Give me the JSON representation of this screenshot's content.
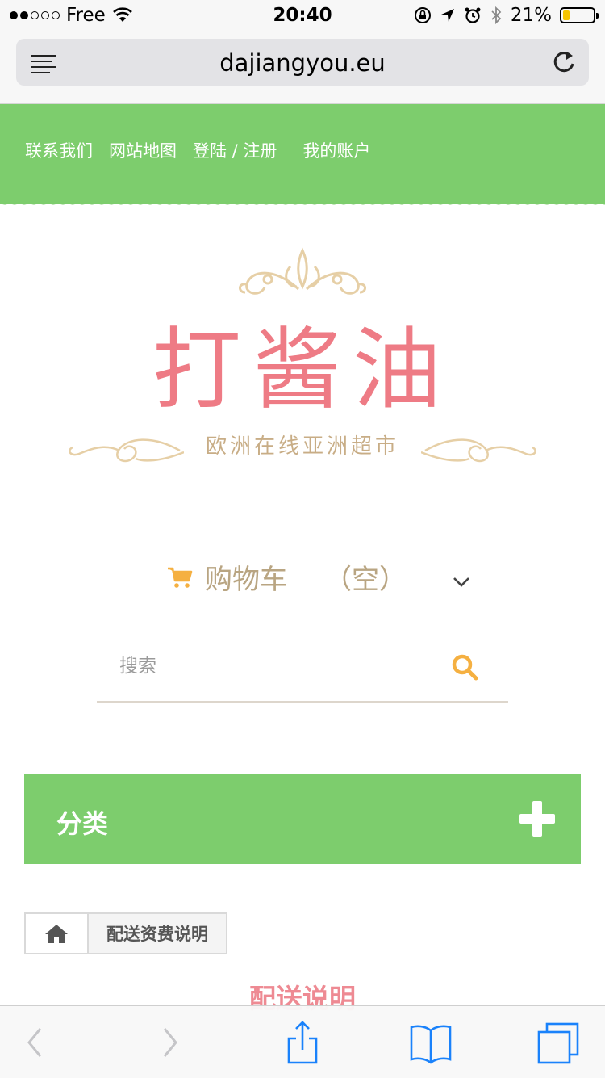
{
  "status_bar": {
    "carrier": "Free",
    "time": "20:40",
    "battery_percent_text": "21%",
    "battery_level": 0.21,
    "signal_dots_filled": 2,
    "signal_dots_total": 5
  },
  "browser": {
    "url": "dajiangyou.eu"
  },
  "topnav": {
    "links": [
      "联系我们",
      "网站地图",
      "登陆 / 注册",
      "我的账户"
    ]
  },
  "logo": {
    "title": "打酱油",
    "subtitle": "欧洲在线亚洲超市"
  },
  "cart": {
    "label": "购物车",
    "status": "（空）"
  },
  "search": {
    "placeholder": "搜索"
  },
  "category": {
    "label": "分类"
  },
  "breadcrumb": {
    "current": "配送资费说明"
  },
  "page": {
    "heading": "配送说明"
  },
  "colors": {
    "green": "#7dcd6d",
    "accent_orange": "#f5b041",
    "logo_pink": "#ee7b85",
    "logo_gold": "#c8ad86",
    "ios_blue": "#1a82fb"
  }
}
